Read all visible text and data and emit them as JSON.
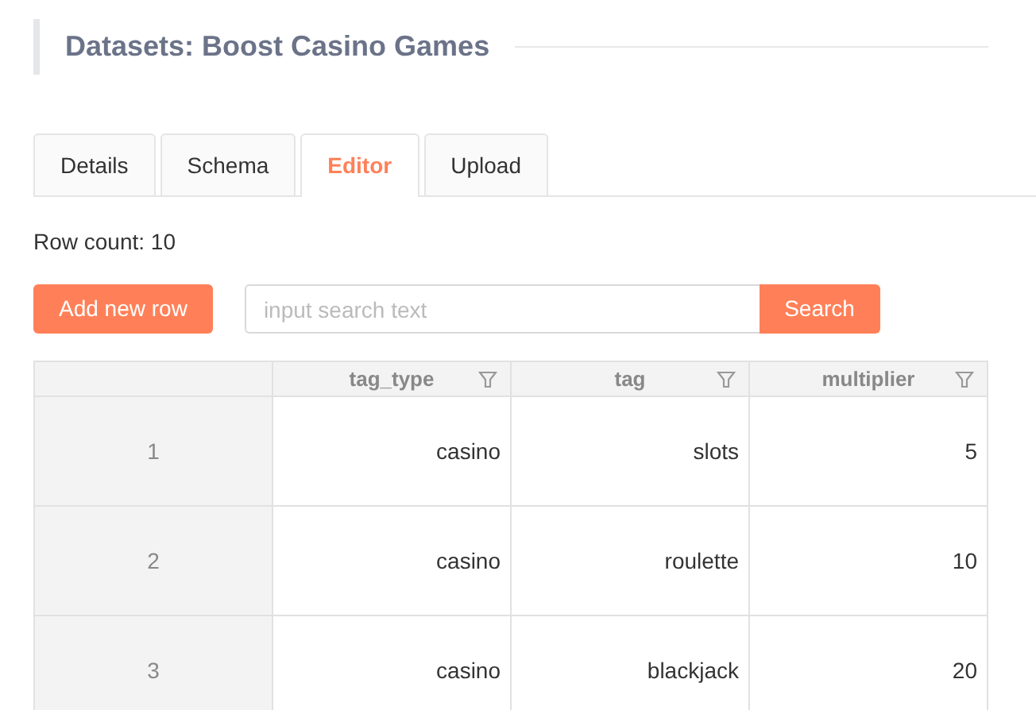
{
  "title": "Datasets: Boost Casino Games",
  "tabs": [
    {
      "label": "Details",
      "selected": false
    },
    {
      "label": "Schema",
      "selected": false
    },
    {
      "label": "Editor",
      "selected": true
    },
    {
      "label": "Upload",
      "selected": false
    }
  ],
  "row_count": "Row count: 10",
  "add_button": "Add new row",
  "search": {
    "placeholder": "input search text",
    "button": "Search"
  },
  "table": {
    "columns": [
      "tag_type",
      "tag",
      "multiplier"
    ],
    "rows": [
      {
        "index": "1",
        "cells": [
          "casino",
          "slots",
          "5"
        ]
      },
      {
        "index": "2",
        "cells": [
          "casino",
          "roulette",
          "10"
        ]
      },
      {
        "index": "3",
        "cells": [
          "casino",
          "blackjack",
          "20"
        ]
      }
    ]
  }
}
